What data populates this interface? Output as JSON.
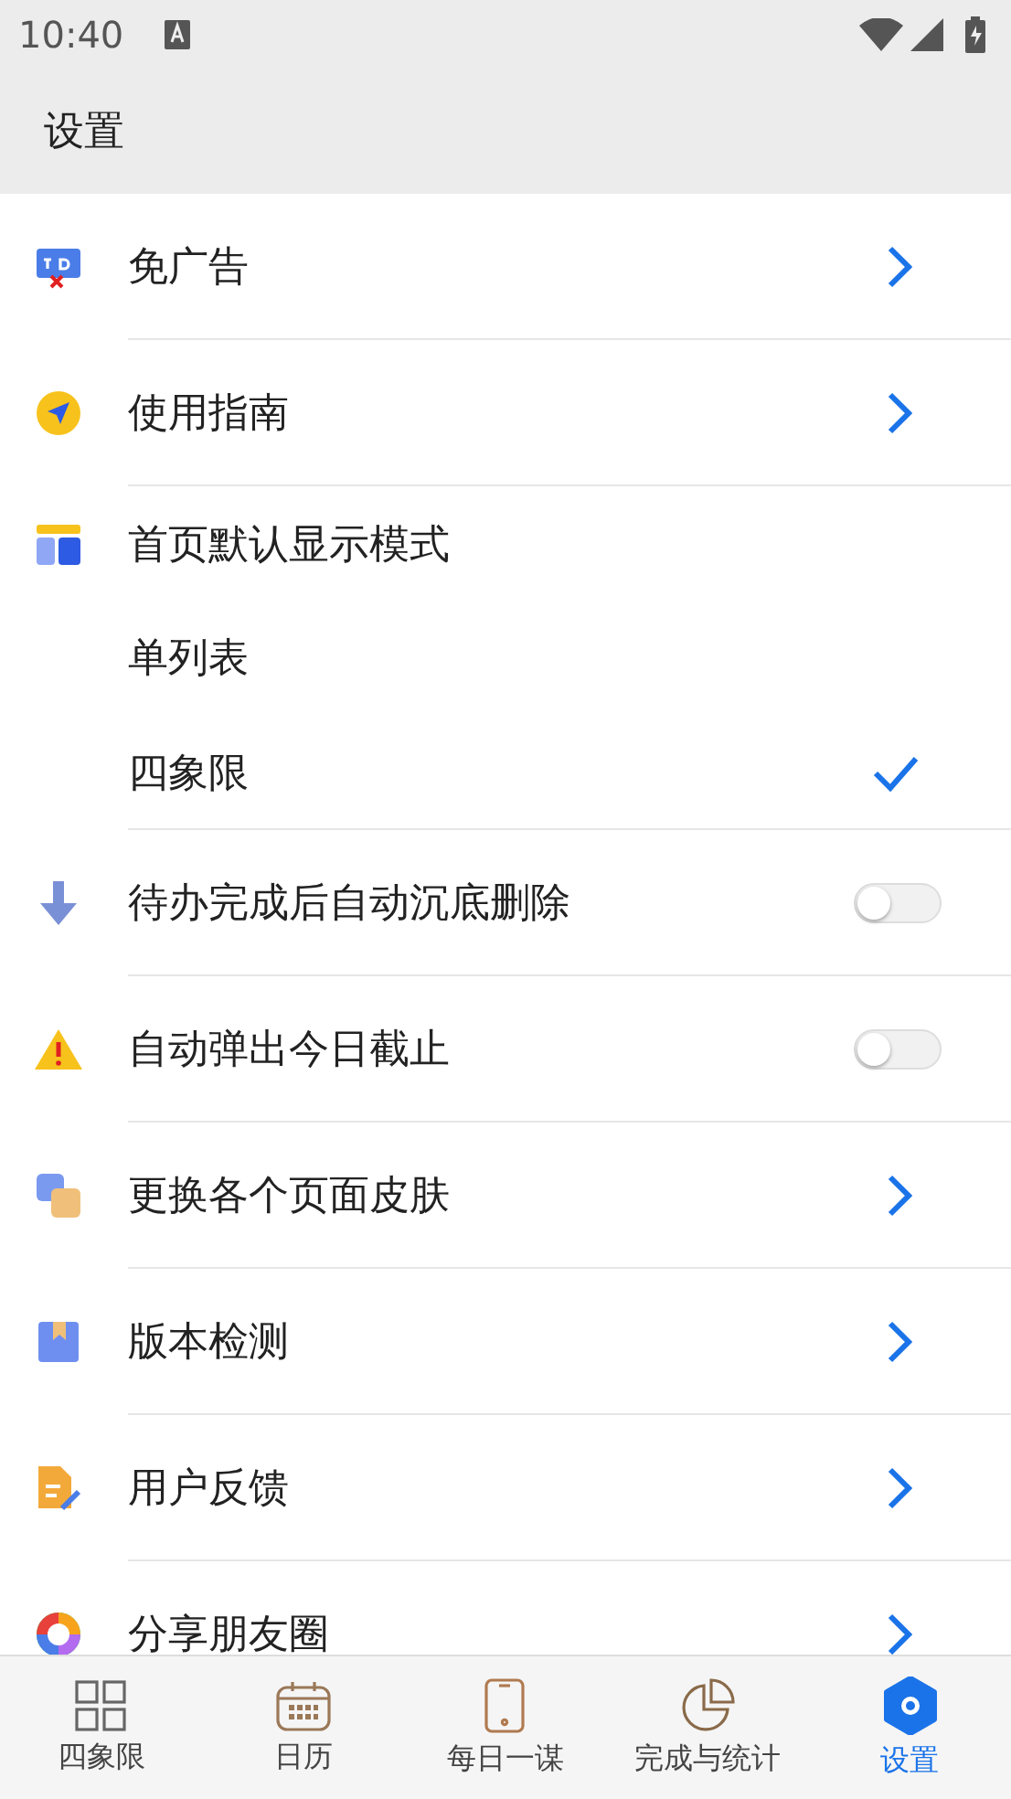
{
  "status_bar": {
    "time": "10:40"
  },
  "header": {
    "title": "设置"
  },
  "settings": [
    {
      "kind": "link",
      "label": "免广告"
    },
    {
      "kind": "link",
      "label": "使用指南"
    },
    {
      "kind": "choice",
      "label": "首页默认显示模式",
      "options": [
        {
          "label": "单列表",
          "selected": false
        },
        {
          "label": "四象限",
          "selected": true
        }
      ]
    },
    {
      "kind": "toggle",
      "label": "待办完成后自动沉底删除",
      "on": false
    },
    {
      "kind": "toggle",
      "label": "自动弹出今日截止",
      "on": false
    },
    {
      "kind": "link",
      "label": "更换各个页面皮肤"
    },
    {
      "kind": "link",
      "label": "版本检测"
    },
    {
      "kind": "link",
      "label": "用户反馈"
    },
    {
      "kind": "link",
      "label": "分享朋友圈"
    }
  ],
  "tabs": [
    {
      "label": "四象限",
      "selected": false
    },
    {
      "label": "日历",
      "selected": false
    },
    {
      "label": "每日一谋",
      "selected": false
    },
    {
      "label": "完成与统计",
      "selected": false
    },
    {
      "label": "设置",
      "selected": true
    }
  ]
}
